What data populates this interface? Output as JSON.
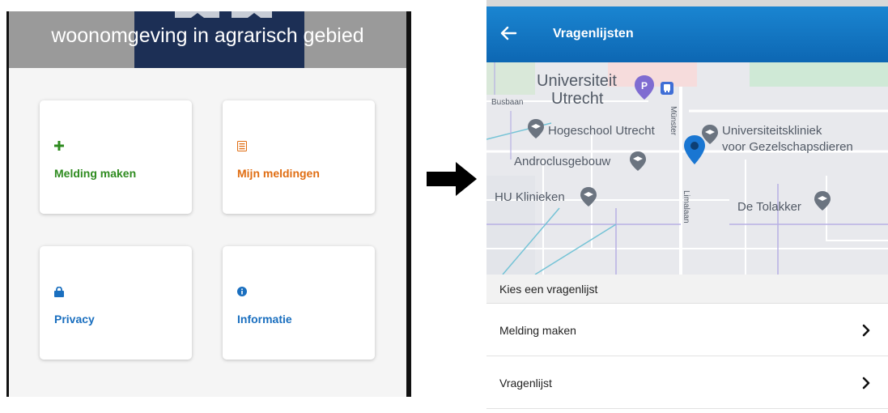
{
  "left": {
    "header_title": "woonomgeving in agrarisch gebied",
    "tiles": [
      {
        "label": "Melding maken",
        "icon": "plus-icon",
        "color": "#2e8b1f"
      },
      {
        "label": "Mijn meldingen",
        "icon": "list-icon",
        "color": "#e06d12"
      },
      {
        "label": "Privacy",
        "icon": "lock-icon",
        "color": "#1a6fbf"
      },
      {
        "label": "Informatie",
        "icon": "info-icon",
        "color": "#1a6fbf"
      }
    ]
  },
  "transition": {
    "icon": "right-arrow-icon"
  },
  "right": {
    "app_bar": {
      "title": "Vragenlijsten",
      "back_icon": "back-arrow-icon",
      "color": "#0f6cb6"
    },
    "map": {
      "labels": {
        "universiteit_utrecht_1": "Universiteit",
        "universiteit_utrecht_2": "Utrecht",
        "busbaan": "Busbaan",
        "hogeschool": "Hogeschool Utrecht",
        "kliniek_1": "Universiteitskliniek",
        "kliniek_2": "voor Gezelschapsdieren",
        "androclus": "Androclusgebouw",
        "hu_klinieken": "HU Klinieken",
        "tolakker": "De Tolakker",
        "munster": "Münster",
        "limalaan": "Limalaan"
      },
      "marker_color": "#1976d2"
    },
    "list_header": "Kies een vragenlijst",
    "items": [
      {
        "label": "Melding maken"
      },
      {
        "label": "Vragenlijst"
      }
    ]
  }
}
